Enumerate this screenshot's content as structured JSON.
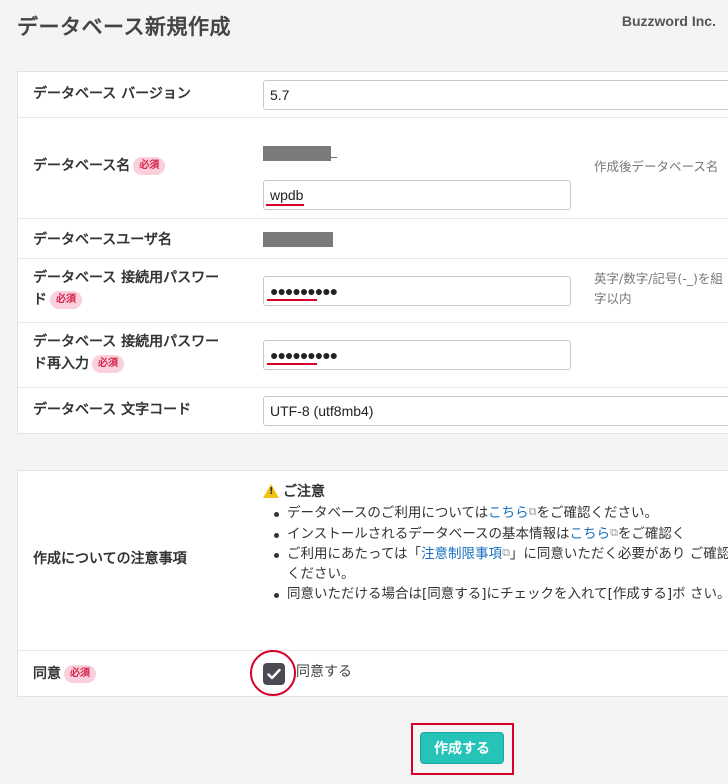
{
  "header": {
    "title": "データベース新規作成",
    "brand": "Buzzword Inc."
  },
  "form": {
    "version": {
      "label": "データベース バージョン",
      "value": "5.7"
    },
    "db_name": {
      "label": "データベース名",
      "required": "必須",
      "prefix_suffix": "_",
      "value": "wpdb",
      "hint": "作成後データベース名"
    },
    "db_user": {
      "label": "データベースユーザ名"
    },
    "password": {
      "label_line1": "データベース 接続用パスワー",
      "label_line2": "ド",
      "required": "必須",
      "value": "●●●●●●●●●",
      "hint_line1": "英字/数字/記号(-_)を組",
      "hint_line2": "字以内"
    },
    "password_confirm": {
      "label_line1": "データベース 接続用パスワー",
      "label_line2": "ド再入力",
      "required": "必須",
      "value": "●●●●●●●●●"
    },
    "charset": {
      "label": "データベース 文字コード",
      "value": "UTF-8 (utf8mb4)"
    }
  },
  "notice": {
    "label": "作成についての注意事項",
    "title": "ご注意",
    "items": [
      {
        "before": "データベースのご利用については",
        "link": "こちら",
        "after": "をご確認ください。"
      },
      {
        "before": "インストールされるデータベースの基本情報は",
        "link": "こちら",
        "after": "をご確認く"
      },
      {
        "before": "ご利用にあたっては「",
        "link": "注意制限事項",
        "after": "」に同意いただく必要があり ご確認ください。"
      },
      {
        "before": "同意いただける場合は[同意する]にチェックを入れて[作成する]ボ さい。",
        "link": "",
        "after": ""
      }
    ]
  },
  "agree": {
    "label": "同意",
    "required": "必須",
    "checkbox_label": "同意する",
    "checked": true
  },
  "submit": {
    "label": "作成する"
  }
}
